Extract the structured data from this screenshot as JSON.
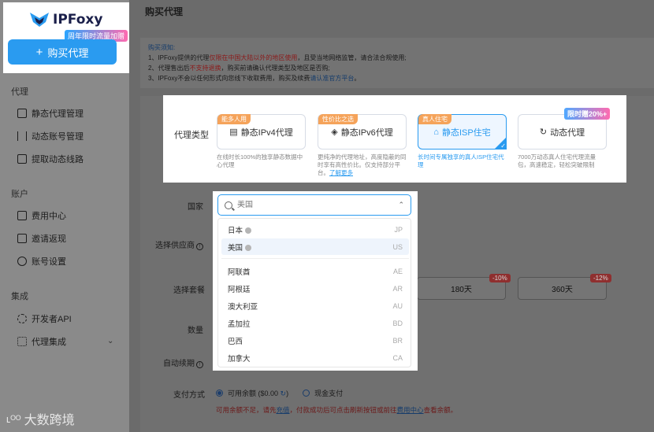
{
  "brand": {
    "name": "IPFoxy",
    "promo": "周年限时流量加赠"
  },
  "buy_button": {
    "icon": "plus-icon",
    "label": "购买代理"
  },
  "sidebar": {
    "groups": [
      {
        "title": "代理",
        "items": [
          {
            "icon": "monitor-icon",
            "label": "静态代理管理"
          },
          {
            "icon": "sliders-icon",
            "label": "动态账号管理"
          },
          {
            "icon": "list-icon",
            "label": "提取动态线路"
          }
        ]
      },
      {
        "title": "账户",
        "items": [
          {
            "icon": "wallet-icon",
            "label": "费用中心"
          },
          {
            "icon": "gift-icon",
            "label": "邀请返现"
          },
          {
            "icon": "user-settings-icon",
            "label": "账号设置"
          }
        ]
      },
      {
        "title": "集成",
        "items": [
          {
            "icon": "code-icon",
            "label": "开发者API"
          },
          {
            "icon": "integration-icon",
            "label": "代理集成"
          }
        ]
      }
    ]
  },
  "watermark": "大数跨境",
  "page_title": "购买代理",
  "notice": {
    "title": "购买须知:",
    "line1_a": "1、IPFoxy提供的代理",
    "line1_red": "仅限在中国大陆以外的地区使用",
    "line1_b": "，且受当地网络监管，请合法合规使用;",
    "line2_a": "2、代理售出后",
    "line2_red": "不支持退换",
    "line2_b": "，购买前请确认代理类型及地区是否购;",
    "line3_a": "3、IPFoxy不会以任何形式向您线下收取费用，购买及续费",
    "line3_blue": "请认准官方平台",
    "line3_b": "。"
  },
  "proxy_type": {
    "label": "代理类型",
    "limited_badge": "限时赠20%+",
    "cards": [
      {
        "tag": "能多人用",
        "icon": "ipv4-icon",
        "label": "静态IPv4代理",
        "desc": "在线时长100%的独享静态数据中心代理"
      },
      {
        "tag": "性价比之选",
        "icon": "ipv6-icon",
        "label": "静态IPv6代理",
        "desc": "更纯净的代理地址，高度隐蔽的同时享有高性价比。仅支持部分平台。",
        "link": "了解更多"
      },
      {
        "tag": "真人住宅",
        "icon": "house-icon",
        "label": "静态ISP住宅",
        "desc": "长时间专属独享的真人ISP住宅代理",
        "selected": true
      },
      {
        "tag": "",
        "icon": "refresh-icon",
        "label": "动态代理",
        "desc": "7000万动态真人住宅代理流量包，高速稳定，轻松突破限制"
      }
    ]
  },
  "country": {
    "label": "国家",
    "placeholder": "美国",
    "items": [
      {
        "name": "日本",
        "code": "JP",
        "verified": true
      },
      {
        "name": "美国",
        "code": "US",
        "verified": true,
        "highlight": true
      },
      {
        "name": "阿联酋",
        "code": "AE"
      },
      {
        "name": "阿根廷",
        "code": "AR"
      },
      {
        "name": "澳大利亚",
        "code": "AU"
      },
      {
        "name": "孟加拉",
        "code": "BD"
      },
      {
        "name": "巴西",
        "code": "BR"
      },
      {
        "name": "加拿大",
        "code": "CA"
      }
    ]
  },
  "supplier": {
    "label": "选择供应商"
  },
  "plan": {
    "label": "选择套餐",
    "options": [
      {
        "label": "180天",
        "badge": "-10%"
      },
      {
        "label": "360天",
        "badge": "-12%"
      }
    ]
  },
  "quantity": {
    "label": "数量"
  },
  "auto_renew": {
    "label": "自动续期"
  },
  "payment": {
    "label": "支付方式",
    "balance_label": "可用余额 ($0.00",
    "balance_close": ")",
    "cash_label": "现金支付",
    "warn_a": "可用余额不足，请先",
    "warn_link1": "充值",
    "warn_b": "，付款成功后可点击刷新按钮或前往",
    "warn_link2": "费用中心",
    "warn_c": "查看余额。"
  },
  "colors": {
    "primary": "#2a9bf0",
    "overlay": "#6b6b6b",
    "danger": "#e94b4b"
  }
}
